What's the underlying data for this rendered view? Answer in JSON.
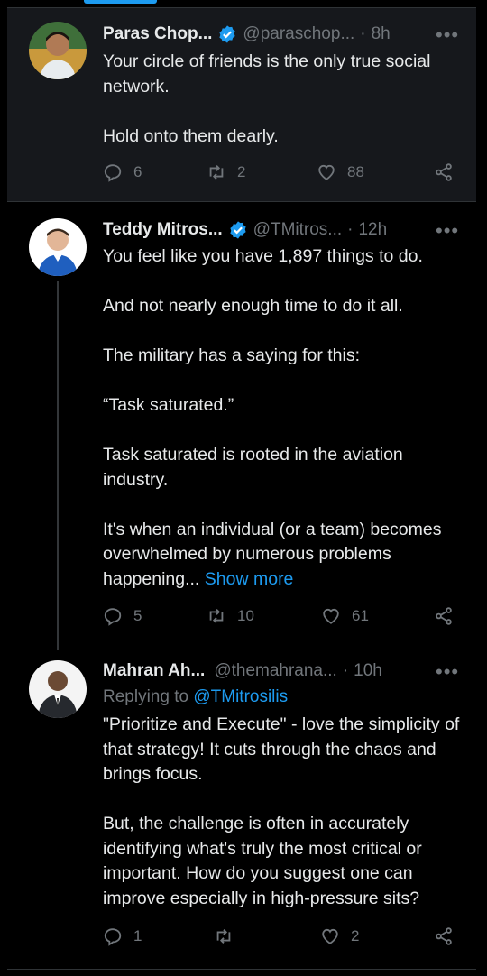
{
  "colors": {
    "background": "#000000",
    "card": "#16181c",
    "text": "#e7e9ea",
    "muted": "#71767b",
    "accent": "#1d9bf0",
    "border": "#2f3336"
  },
  "tweets": [
    {
      "name": "Paras Chop...",
      "handle": "@paraschop...",
      "dot": "·",
      "time": "8h",
      "more": "•••",
      "text": "Your circle of friends is the only true social network.\n\nHold onto them dearly.",
      "replies": "6",
      "reposts": "2",
      "likes": "88",
      "icons": {
        "verified": "verified-badge-icon",
        "reply": "reply-icon",
        "repost": "repost-icon",
        "like": "heart-icon",
        "share": "share-icon"
      }
    },
    {
      "name": "Teddy Mitros...",
      "handle": "@TMitros...",
      "dot": "·",
      "time": "12h",
      "more": "•••",
      "text": "You feel like you have 1,897 things to do.\n\nAnd not nearly enough time to do it all.\n\nThe military has a saying for this:\n\n“Task saturated.”\n\nTask saturated is rooted in the aviation industry.\n\nIt's when an individual (or a team) becomes overwhelmed by numerous problems happening...",
      "show_more": "Show more",
      "replies": "5",
      "reposts": "10",
      "likes": "61"
    },
    {
      "name": "Mahran Ah...",
      "handle": "@themahrana...",
      "dot": "·",
      "time": "10h",
      "more": "•••",
      "replying_prefix": "Replying to",
      "replying_to": "@TMitrosilis",
      "text": "\"Prioritize and Execute\" - love the simplicity of that strategy! It cuts through the chaos and brings focus.\n\nBut, the challenge is often in accurately identifying what's truly the most critical or important. How do you suggest one can improve especially in high-pressure sits?",
      "replies": "1",
      "reposts": "",
      "likes": "2"
    }
  ]
}
